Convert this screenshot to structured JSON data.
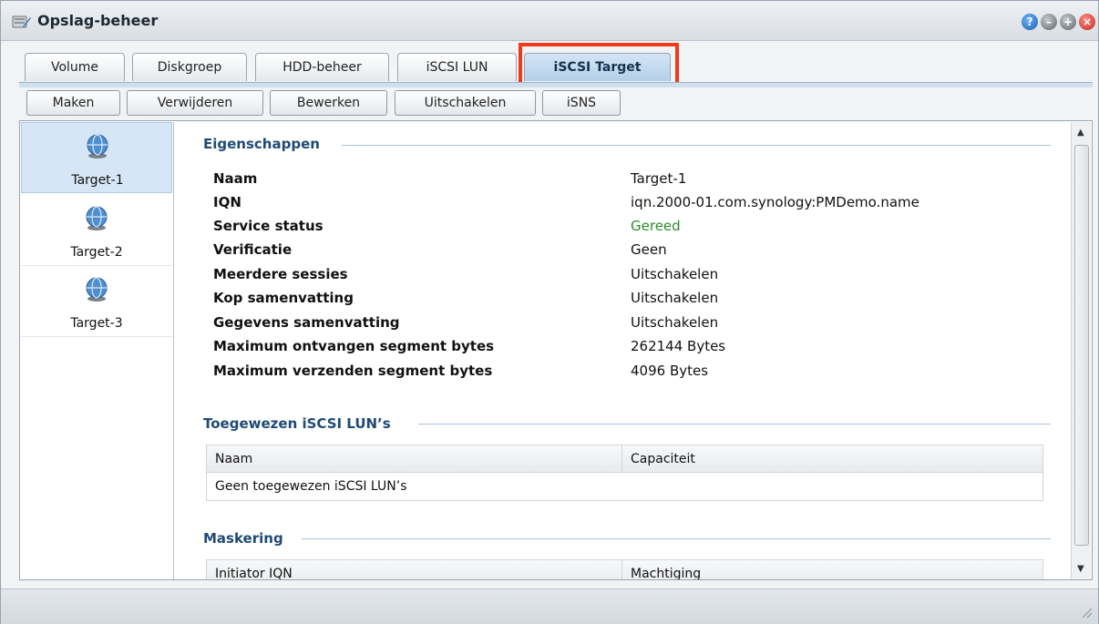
{
  "window": {
    "title": "Opslag-beheer",
    "icon": "storage-manager-icon"
  },
  "tabs": [
    {
      "label": "Volume"
    },
    {
      "label": "Diskgroep"
    },
    {
      "label": "HDD-beheer"
    },
    {
      "label": "iSCSI LUN"
    },
    {
      "label": "iSCSI Target",
      "active": true
    }
  ],
  "toolbar": {
    "create": "Maken",
    "delete": "Verwijderen",
    "edit": "Bewerken",
    "disable": "Uitschakelen",
    "isns": "iSNS"
  },
  "targets": [
    {
      "label": "Target-1",
      "selected": true
    },
    {
      "label": "Target-2"
    },
    {
      "label": "Target-3"
    }
  ],
  "properties": {
    "section_title": "Eigenschappen",
    "rows": [
      {
        "label": "Naam",
        "value": "Target-1"
      },
      {
        "label": "IQN",
        "value": "iqn.2000-01.com.synology:PMDemo.name"
      },
      {
        "label": "Service status",
        "value": "Gereed"
      },
      {
        "label": "Verificatie",
        "value": "Geen"
      },
      {
        "label": "Meerdere sessies",
        "value": "Uitschakelen"
      },
      {
        "label": "Kop samenvatting",
        "value": "Uitschakelen"
      },
      {
        "label": "Gegevens samenvatting",
        "value": "Uitschakelen"
      },
      {
        "label": "Maximum ontvangen segment bytes",
        "value": "262144 Bytes"
      },
      {
        "label": "Maximum verzenden segment bytes",
        "value": "4096 Bytes"
      }
    ]
  },
  "luns": {
    "section_title": "Toegewezen iSCSI LUN’s",
    "columns": [
      "Naam",
      "Capaciteit"
    ],
    "empty_text": "Geen toegewezen iSCSI LUN’s"
  },
  "masking": {
    "section_title": "Maskering",
    "columns": [
      "Initiator IQN",
      "Machtiging"
    ]
  },
  "colors": {
    "highlight": "#ef3b1b",
    "status_ready": "#2e8b2e",
    "section_title": "#1f4a75"
  }
}
